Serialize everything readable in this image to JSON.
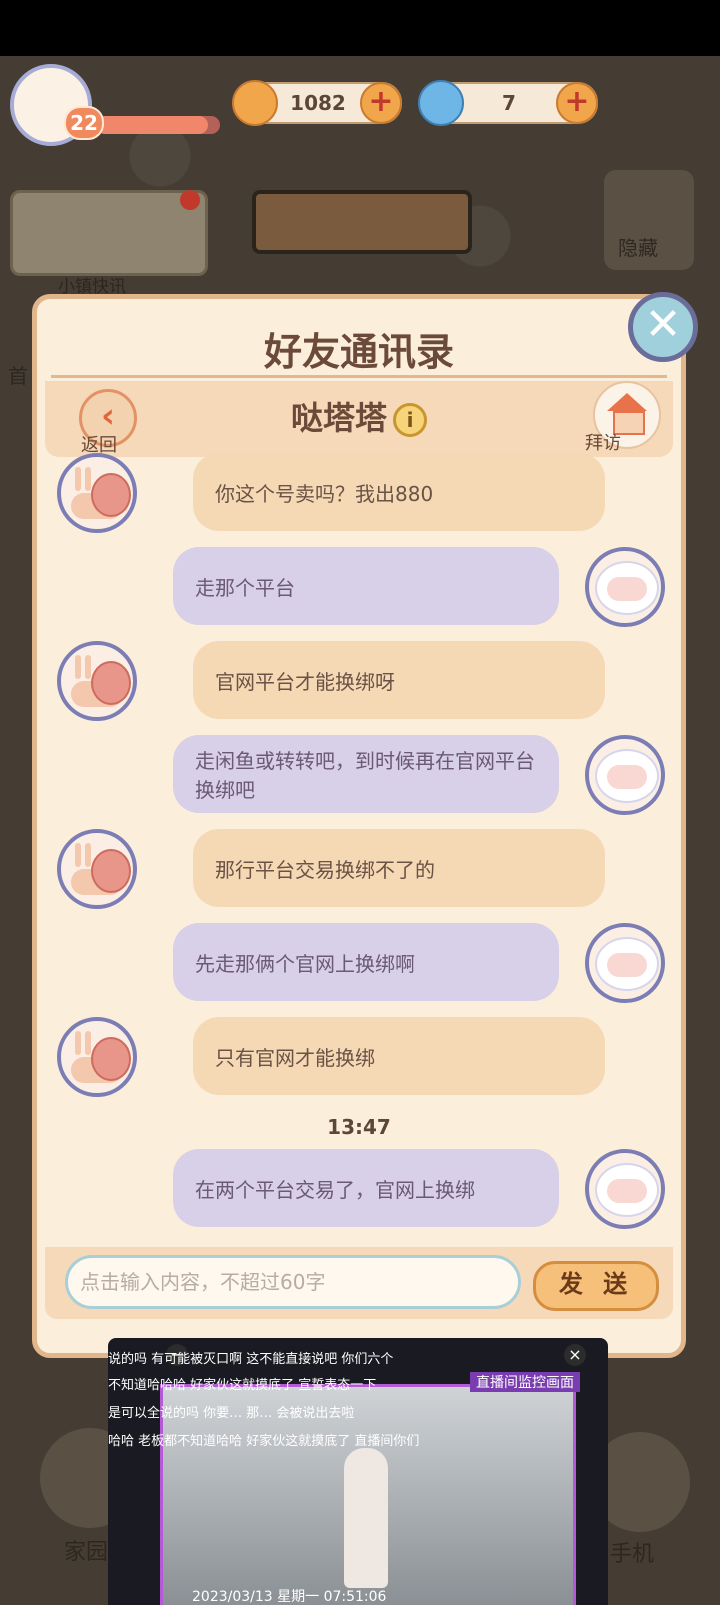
{
  "hud": {
    "level": "22",
    "xp_fraction": 0.9,
    "coins": "1082",
    "swirls": "7"
  },
  "sidebar": {
    "news_label": "小镇快讯",
    "hide_label": "隐藏",
    "left_label_partial": "首"
  },
  "dialog": {
    "title": "好友通讯录",
    "friend_name": "哒塔塔",
    "back_label": "返回",
    "visit_label": "拜访",
    "messages": [
      {
        "from": "friend",
        "text": "你这个号卖吗？我出880"
      },
      {
        "from": "me",
        "text": "走那个平台"
      },
      {
        "from": "friend",
        "text": "官网平台才能换绑呀"
      },
      {
        "from": "me",
        "text": "走闲鱼或转转吧，到时候再在官网平台换绑吧"
      },
      {
        "from": "friend",
        "text": "那行平台交易换绑不了的"
      },
      {
        "from": "me",
        "text": "先走那俩个官网上换绑啊"
      },
      {
        "from": "friend",
        "text": "只有官网才能换绑"
      },
      {
        "from": "time",
        "text": "13:47"
      },
      {
        "from": "me",
        "text": "在两个平台交易了，官网上换绑"
      }
    ],
    "input_placeholder": "点击输入内容，不超过60字",
    "send_label": "发 送"
  },
  "bottom": {
    "home_label": "家园",
    "phone_label": "手机"
  },
  "video": {
    "title": "直播间监控画面",
    "timestamp": "2023/03/13 星期一 07:51:06",
    "danmaku": [
      "说的吗    有可能被灭口啊    这不能直接说吧    你们六个",
      "不知道哈哈哈   好家伙这就摸底了    宣誓表态一下",
      "是可以全说的吗    你要…  那…   会被说出去啦",
      "哈哈    老板都不知道哈哈    好家伙这就摸底了    直播间你们"
    ]
  }
}
